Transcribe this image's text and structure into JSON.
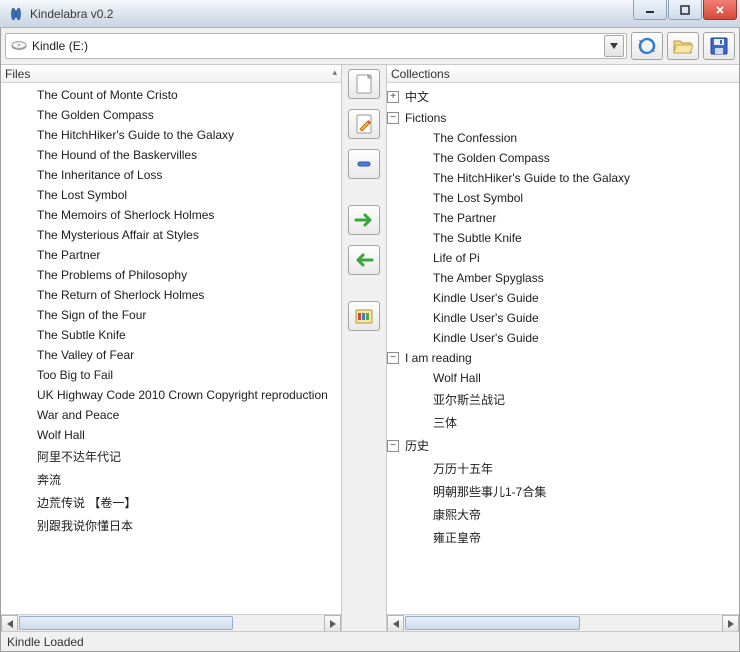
{
  "window": {
    "title": "Kindelabra v0.2"
  },
  "toolbar": {
    "drive_label": "Kindle (E:)"
  },
  "panels": {
    "files_header": "Files",
    "collections_header": "Collections"
  },
  "files": [
    "The Count of Monte Cristo",
    "The Golden Compass",
    "The HitchHiker's Guide to the Galaxy",
    "The Hound of the Baskervilles",
    "The Inheritance of Loss",
    "The Lost Symbol",
    "The Memoirs of Sherlock Holmes",
    "The Mysterious Affair at Styles",
    "The Partner",
    "The Problems of Philosophy",
    "The Return of Sherlock Holmes",
    "The Sign of the Four",
    "The Subtle Knife",
    "The Valley of Fear",
    "Too Big to Fail",
    "UK Highway Code 2010 Crown Copyright reproduction",
    "War and Peace",
    "Wolf Hall",
    "阿里不达年代记",
    "奔流",
    "边荒传说 【卷一】",
    "别跟我说你懂日本"
  ],
  "collections": [
    {
      "label": "中文",
      "state": "plus",
      "children": []
    },
    {
      "label": "Fictions",
      "state": "minus",
      "children": [
        "The Confession",
        "The Golden Compass",
        "The HitchHiker's Guide to the Galaxy",
        "The Lost Symbol",
        "The Partner",
        "The Subtle Knife",
        "Life of Pi",
        "The Amber Spyglass",
        "Kindle User's Guide",
        "Kindle User's Guide",
        "Kindle User's Guide"
      ]
    },
    {
      "label": "I am reading",
      "state": "minus",
      "children": [
        "Wolf Hall",
        "亚尔斯兰战记",
        "三体"
      ]
    },
    {
      "label": "历史",
      "state": "minus",
      "children": [
        "万历十五年",
        "明朝那些事儿1-7合集",
        "康熙大帝",
        "雍正皇帝"
      ]
    }
  ],
  "status": "Kindle Loaded"
}
